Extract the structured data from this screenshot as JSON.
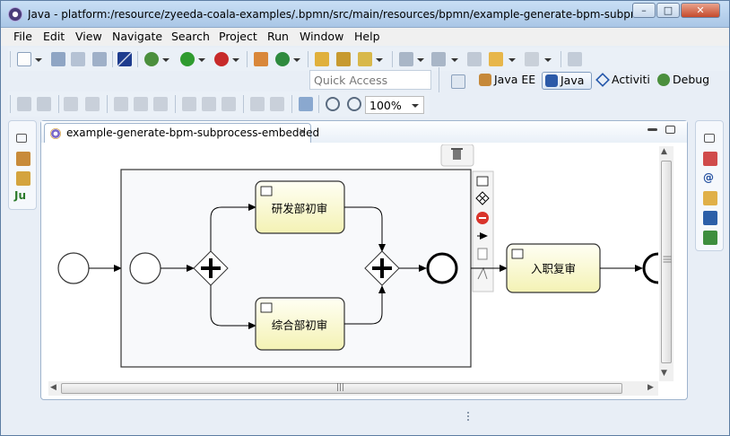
{
  "window": {
    "title": "Java - platform:/resource/zyeeda-coala-examples/.bpmn/src/main/resources/bpmn/example-generate-bpm-subpr...",
    "buttons": {
      "minimize": "–",
      "maximize": "□",
      "close": "✕"
    }
  },
  "menu": [
    "File",
    "Edit",
    "View",
    "Navigate",
    "Search",
    "Project",
    "Run",
    "Window",
    "Help"
  ],
  "toolbar": {
    "quick_access_placeholder": "Quick Access",
    "zoom_value": "100%"
  },
  "perspectives": [
    {
      "label": "Java EE",
      "icon": "java-ee-perspective-icon",
      "active": false
    },
    {
      "label": "Java",
      "icon": "java-perspective-icon",
      "active": true
    },
    {
      "label": "Activiti",
      "icon": "activiti-perspective-icon",
      "active": false
    },
    {
      "label": "Debug",
      "icon": "debug-perspective-icon",
      "active": false
    }
  ],
  "left_panel_icons": [
    "restore-icon",
    "hierarchy-icon",
    "package-explorer-icon",
    "junit-icon"
  ],
  "right_panel_icons": [
    "restore-icon",
    "problems-icon",
    "javadoc-icon",
    "declaration-icon",
    "console-icon",
    "progress-icon"
  ],
  "editor": {
    "tab_label": "example-generate-bpm-subprocess-embedded",
    "tab_close": "✕",
    "scrollbar_grip": "|||"
  },
  "diagram": {
    "tasks": {
      "rd_review": "研发部初审",
      "general_review": "综合部初审",
      "entry_recheck": "入职复审"
    },
    "context_pad_icons": [
      "delete-icon",
      "user-task-icon",
      "gateway-icon",
      "end-event-icon",
      "connection-icon",
      "annotation-icon",
      "change-type-icon"
    ]
  },
  "colors": {
    "task_fill_top": "#fffff4",
    "task_fill_bottom": "#f4f2b4",
    "task_stroke": "#333333",
    "subprocess_fill": "#f8f9fb"
  }
}
